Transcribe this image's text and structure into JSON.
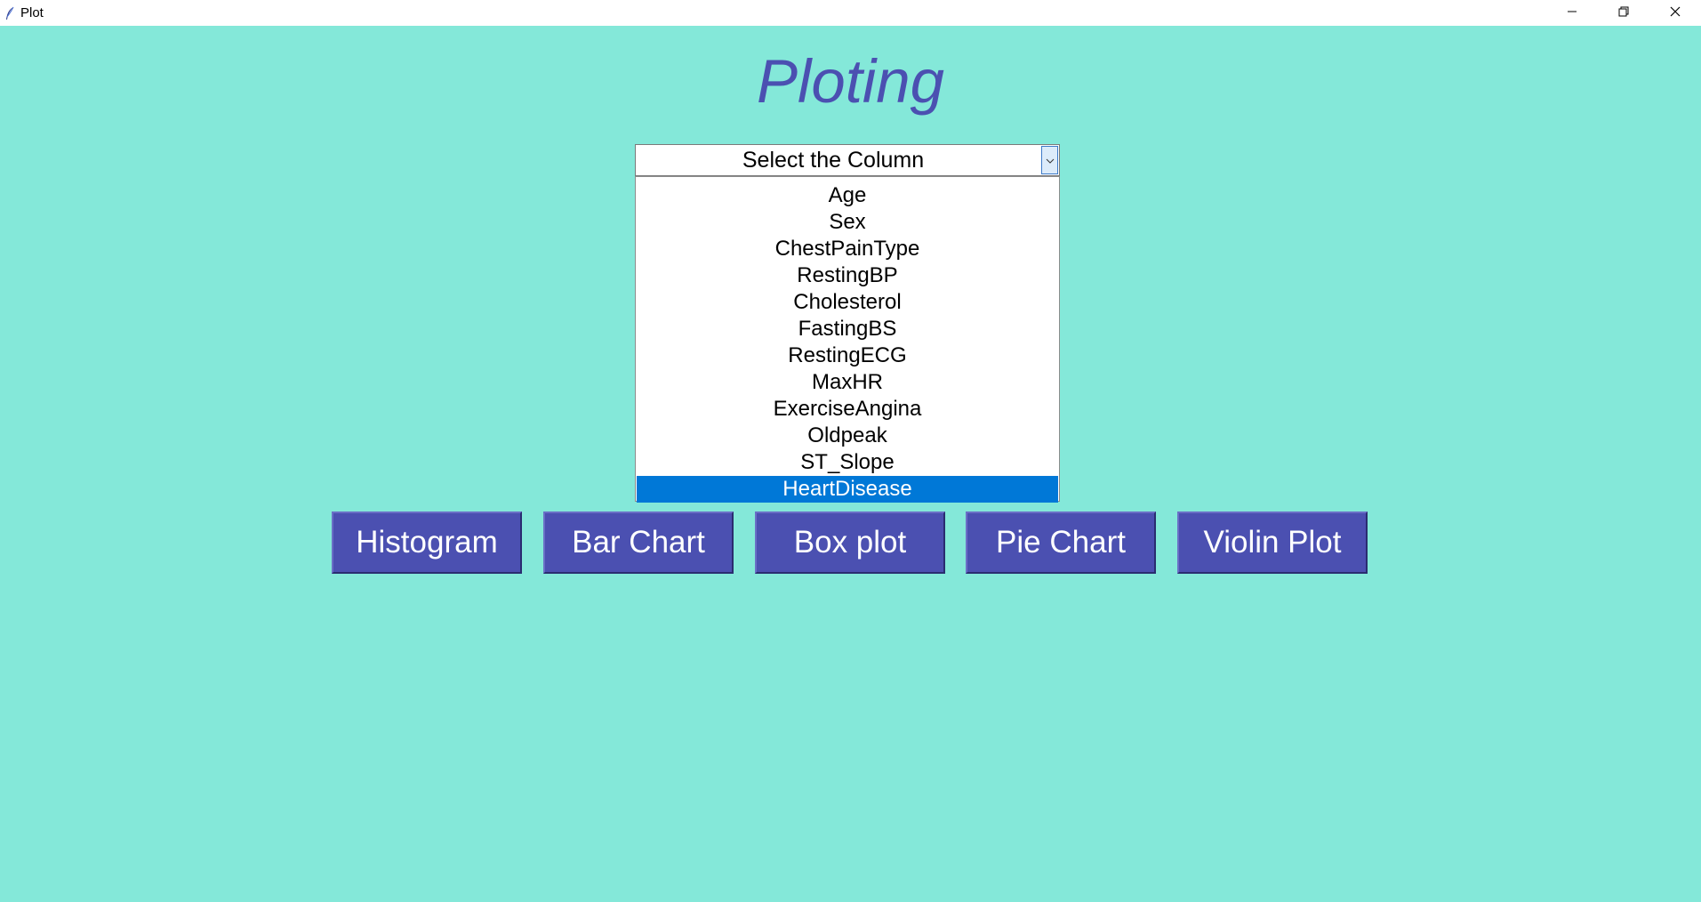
{
  "window": {
    "title": "Plot",
    "icon": "feather-icon"
  },
  "heading": "Ploting",
  "combobox": {
    "value": "Select the Column",
    "arrow_icon": "chevron-down-icon"
  },
  "dropdown": {
    "options": [
      "Age",
      "Sex",
      "ChestPainType",
      "RestingBP",
      "Cholesterol",
      "FastingBS",
      "RestingECG",
      "MaxHR",
      "ExerciseAngina",
      "Oldpeak",
      "ST_Slope",
      "HeartDisease"
    ],
    "highlighted": "HeartDisease"
  },
  "buttons": {
    "histogram": "Histogram",
    "bar_chart": "Bar Chart",
    "box_plot": "Box plot",
    "pie_chart": "Pie Chart",
    "violin_plot": "Violin Plot"
  },
  "colors": {
    "background": "#84e8d9",
    "accent": "#4b50b1",
    "selection": "#0078d7"
  }
}
